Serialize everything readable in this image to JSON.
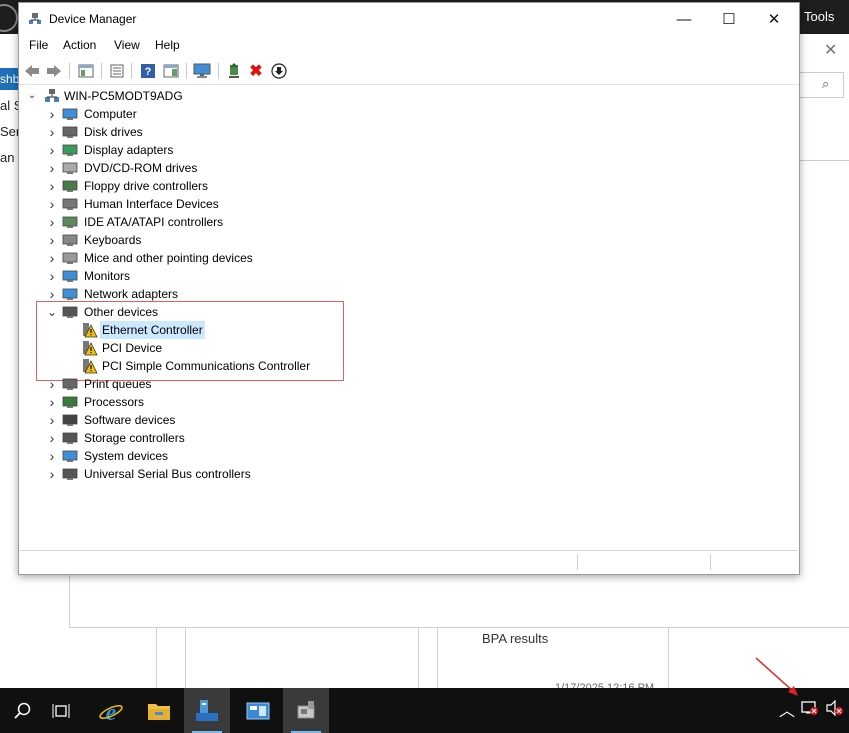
{
  "server_manager": {
    "tools_label": "Tools",
    "dashboard_partial": "shb",
    "left_items": [
      "al S",
      "Ser",
      "an"
    ],
    "bpa_results": "BPA results",
    "timestamp_partial": "1/17/2025 12:16 PM"
  },
  "device_manager": {
    "title": "Device Manager",
    "window_controls": {
      "minimize": "—",
      "maximize": "☐",
      "close": "✕"
    },
    "menu": [
      "File",
      "Action",
      "View",
      "Help"
    ],
    "toolbar_icons": [
      "back-arrow-icon",
      "forward-arrow-icon",
      "show-hide-console-tree-icon",
      "properties-icon",
      "help-icon",
      "action-pane-icon",
      "monitor-icon",
      "update-driver-icon",
      "uninstall-x-icon",
      "download-icon"
    ],
    "tree": {
      "root": "WIN-PC5MODT9ADG",
      "categories": [
        {
          "label": "Computer",
          "icon": "computer-icon",
          "expanded": false
        },
        {
          "label": "Disk drives",
          "icon": "disk-drive-icon",
          "expanded": false
        },
        {
          "label": "Display adapters",
          "icon": "display-adapter-icon",
          "expanded": false
        },
        {
          "label": "DVD/CD-ROM drives",
          "icon": "dvd-icon",
          "expanded": false
        },
        {
          "label": "Floppy drive controllers",
          "icon": "floppy-controller-icon",
          "expanded": false
        },
        {
          "label": "Human Interface Devices",
          "icon": "hid-icon",
          "expanded": false
        },
        {
          "label": "IDE ATA/ATAPI controllers",
          "icon": "ide-controller-icon",
          "expanded": false
        },
        {
          "label": "Keyboards",
          "icon": "keyboard-icon",
          "expanded": false
        },
        {
          "label": "Mice and other pointing devices",
          "icon": "mouse-icon",
          "expanded": false
        },
        {
          "label": "Monitors",
          "icon": "monitor-icon",
          "expanded": false
        },
        {
          "label": "Network adapters",
          "icon": "network-adapter-icon",
          "expanded": false
        },
        {
          "label": "Other devices",
          "icon": "other-devices-icon",
          "expanded": true,
          "children": [
            {
              "label": "Ethernet Controller",
              "icon": "warning-device-icon",
              "selected": true
            },
            {
              "label": "PCI Device",
              "icon": "warning-device-icon",
              "selected": false
            },
            {
              "label": "PCI Simple Communications Controller",
              "icon": "warning-device-icon",
              "selected": false
            }
          ]
        },
        {
          "label": "Print queues",
          "icon": "printer-icon",
          "expanded": false
        },
        {
          "label": "Processors",
          "icon": "processor-icon",
          "expanded": false
        },
        {
          "label": "Software devices",
          "icon": "software-device-icon",
          "expanded": false
        },
        {
          "label": "Storage controllers",
          "icon": "storage-controller-icon",
          "expanded": false
        },
        {
          "label": "System devices",
          "icon": "system-devices-icon",
          "expanded": false
        },
        {
          "label": "Universal Serial Bus controllers",
          "icon": "usb-icon",
          "expanded": false
        }
      ]
    }
  },
  "taskbar": {
    "items": [
      "search-icon",
      "task-view-icon",
      "internet-explorer-icon",
      "file-explorer-icon",
      "server-manager-icon",
      "control-panel-icon",
      "device-manager-icon"
    ],
    "tray": [
      "show-hidden-icons-chevron",
      "network-disconnected-icon",
      "volume-muted-icon"
    ]
  },
  "colors": {
    "selection": "#cce8ff",
    "highlight_box": "#e06060",
    "taskbar": "#101010",
    "warning": "#f2c200"
  }
}
